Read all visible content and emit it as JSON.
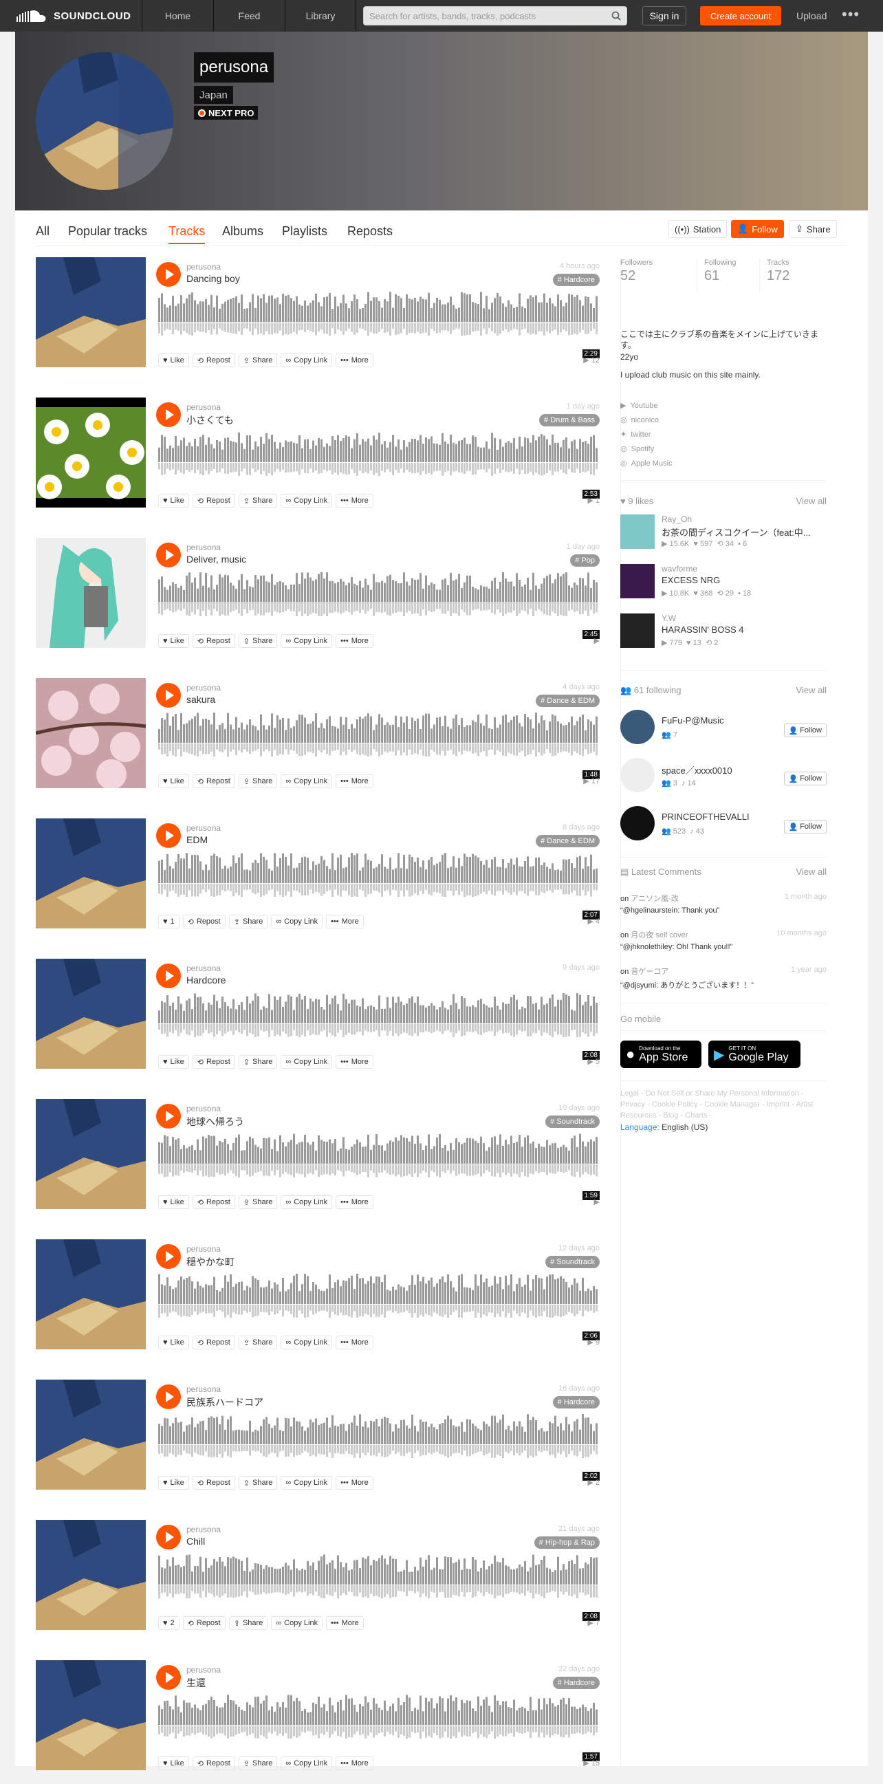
{
  "topbar": {
    "brand": "SOUNDCLOUD",
    "nav": [
      "Home",
      "Feed",
      "Library"
    ],
    "search_placeholder": "Search for artists, bands, tracks, podcasts",
    "signin": "Sign in",
    "create": "Create account",
    "upload": "Upload",
    "more": "•••"
  },
  "profile": {
    "name": "perusona",
    "country": "Japan",
    "badge": "NEXT PRO"
  },
  "tabs": [
    "All",
    "Popular tracks",
    "Tracks",
    "Albums",
    "Playlists",
    "Reposts"
  ],
  "active_tab": "Tracks",
  "header_buttons": {
    "station": "Station",
    "follow": "Follow",
    "share": "Share"
  },
  "action_labels": {
    "like": "Like",
    "repost": "Repost",
    "share": "Share",
    "copy": "Copy Link",
    "more": "More"
  },
  "tracks": [
    {
      "user": "perusona",
      "title": "Dancing boy",
      "time": "4 hours ago",
      "genre": "# Hardcore",
      "duration": "2:29",
      "plays": "12",
      "likes": "Like",
      "art": "guitar"
    },
    {
      "user": "perusona",
      "title": "小さくても",
      "time": "1 day ago",
      "genre": "# Drum & Bass",
      "duration": "2:53",
      "plays": "1",
      "likes": "Like",
      "art": "daisy"
    },
    {
      "user": "perusona",
      "title": "Deliver, music",
      "time": "1 day ago",
      "genre": "# Pop",
      "duration": "2:45",
      "plays": "",
      "likes": "Like",
      "art": "miku"
    },
    {
      "user": "perusona",
      "title": "sakura",
      "time": "4 days ago",
      "genre": "# Dance & EDM",
      "duration": "1:48",
      "plays": "17",
      "likes": "Like",
      "art": "sakura"
    },
    {
      "user": "perusona",
      "title": "EDM",
      "time": "8 days ago",
      "genre": "# Dance & EDM",
      "duration": "2:07",
      "plays": "4",
      "likes": "1",
      "art": "guitar"
    },
    {
      "user": "perusona",
      "title": "Hardcore",
      "time": "9 days ago",
      "genre": "",
      "duration": "2:08",
      "plays": "5",
      "likes": "Like",
      "art": "guitar"
    },
    {
      "user": "perusona",
      "title": "地球へ帰ろう",
      "time": "10 days ago",
      "genre": "# Soundtrack",
      "duration": "1:59",
      "plays": "",
      "likes": "Like",
      "art": "guitar"
    },
    {
      "user": "perusona",
      "title": "穏やかな町",
      "time": "12 days ago",
      "genre": "# Soundtrack",
      "duration": "2:06",
      "plays": "9",
      "likes": "Like",
      "art": "guitar"
    },
    {
      "user": "perusona",
      "title": "民族系ハードコア",
      "time": "16 days ago",
      "genre": "# Hardcore",
      "duration": "2:02",
      "plays": "2",
      "likes": "Like",
      "art": "guitar"
    },
    {
      "user": "perusona",
      "title": "Chill",
      "time": "21 days ago",
      "genre": "# Hip-hop & Rap",
      "duration": "2:08",
      "plays": "7",
      "likes": "2",
      "art": "guitar"
    },
    {
      "user": "perusona",
      "title": "生還",
      "time": "22 days ago",
      "genre": "# Hardcore",
      "duration": "1:57",
      "plays": "15",
      "likes": "Like",
      "art": "guitar"
    }
  ],
  "sidebar": {
    "stats": [
      {
        "label": "Followers",
        "value": "52"
      },
      {
        "label": "Following",
        "value": "61"
      },
      {
        "label": "Tracks",
        "value": "172"
      }
    ],
    "bio_jp": "ここでは主にクラブ系の音楽をメインに上げていきます。",
    "bio_age": "22yo",
    "bio_en": "I upload club music on this site mainly.",
    "links": [
      "Youtube",
      "niconico",
      "twitter",
      "Spotify",
      "Apple Music"
    ],
    "likes_header": "9 likes",
    "view_all": "View all",
    "liked": [
      {
        "user": "Ray_Oh",
        "title": "お茶の間ディスコクイーン（feat:中...",
        "plays": "15.6K",
        "likes": "597",
        "reposts": "34",
        "comments": "6"
      },
      {
        "user": "wavforme",
        "title": "EXCESS NRG",
        "plays": "10.8K",
        "likes": "368",
        "reposts": "29",
        "comments": "18"
      },
      {
        "user": "Y.W",
        "title": "HARASSIN' BOSS 4",
        "plays": "779",
        "likes": "13",
        "reposts": "2",
        "comments": ""
      }
    ],
    "following_header": "61 following",
    "following": [
      {
        "name": "FuFu-P@Music",
        "followers": "7",
        "tracks": ""
      },
      {
        "name": "space／xxxx0010",
        "followers": "3",
        "tracks": "14"
      },
      {
        "name": "PRINCEOFTHEVALLI",
        "followers": "523",
        "tracks": "43"
      }
    ],
    "follow_label": "Follow",
    "comments_header": "Latest Comments",
    "comments": [
      {
        "on": "on",
        "track": "アニソン風-改",
        "time": "1 month ago",
        "text": "“@hgelinaurstein: Thank you”"
      },
      {
        "on": "on",
        "track": "月の夜 self cover",
        "time": "10 months ago",
        "text": "“@jhknolethiley: Oh! Thank you!!”"
      },
      {
        "on": "on",
        "track": "音ゲーコア",
        "time": "1 year ago",
        "text": "“@djsyumi: ありがとうございます！！”"
      }
    ],
    "go_mobile": "Go mobile",
    "appstore_small": "Download on the",
    "appstore": "App Store",
    "gplay_small": "GET IT ON",
    "gplay": "Google Play",
    "legal": "Legal - Do Not Sell or Share My Personal Information - Privacy - Cookie Policy - Cookie Manager - Imprint - Artist Resources - Blog - Charts -",
    "language_label": "Language:",
    "language": "English (US)"
  },
  "colors": {
    "accent": "#ff5500",
    "topbar": "#333333"
  }
}
